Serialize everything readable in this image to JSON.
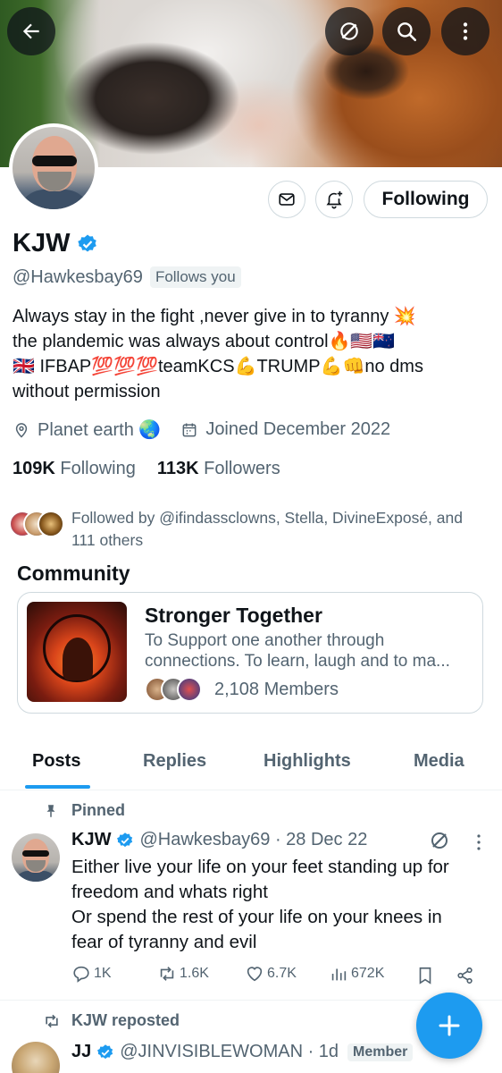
{
  "profile": {
    "name": "KJW",
    "handle": "@Hawkesbay69",
    "follows_you": "Follows you",
    "following_button": "Following",
    "bio_lines": [
      "Always stay in the fight ,never give in to tyranny 💥",
      "the plandemic was always about control🔥🇺🇸🇳🇿",
      "🇬🇧 IFBAP💯💯💯teamKCS💪TRUMP💪👊no dms",
      "without permission"
    ],
    "location": "Planet earth 🌏",
    "joined": "Joined December 2022",
    "following_count": "109K",
    "following_label": "Following",
    "followers_count": "113K",
    "followers_label": "Followers",
    "followed_by": "Followed by @ifindassclowns, Stella, DivineExposé, and 111 others"
  },
  "community": {
    "section_title": "Community",
    "name": "Stronger Together",
    "description": "To Support one another through connections. To learn, laugh and to ma...",
    "members": "2,108 Members"
  },
  "tabs": [
    {
      "label": "Posts",
      "active": true
    },
    {
      "label": "Replies",
      "active": false
    },
    {
      "label": "Highlights",
      "active": false
    },
    {
      "label": "Media",
      "active": false
    }
  ],
  "pinned_post": {
    "pinned_label": "Pinned",
    "author": "KJW",
    "handle_date": "@Hawkesbay69 · 28 Dec 22",
    "text_lines": [
      "Either live your life on your feet standing up for",
      "freedom and whats right",
      "Or spend the rest of your life on your knees in",
      "fear of tyranny and evil"
    ],
    "replies": "1K",
    "reposts": "1.6K",
    "likes": "6.7K",
    "views": "672K"
  },
  "repost": {
    "repost_label": "KJW reposted",
    "author": "JJ",
    "handle_date": "@JINVISIBLEWOMAN · 1d",
    "badge": "Member"
  },
  "colors": {
    "accent": "#1d9bf0",
    "secondary_text": "#536471",
    "primary_text": "#0f1419",
    "border": "#cfd9de"
  },
  "icons": [
    "back-arrow-icon",
    "grok-icon",
    "search-icon",
    "more-vertical-icon",
    "message-icon",
    "bell-plus-icon",
    "verified-badge-icon",
    "location-icon",
    "calendar-icon",
    "pin-icon",
    "reply-icon",
    "repost-icon",
    "like-icon",
    "views-icon",
    "bookmark-icon",
    "share-icon",
    "compose-plus-icon"
  ]
}
